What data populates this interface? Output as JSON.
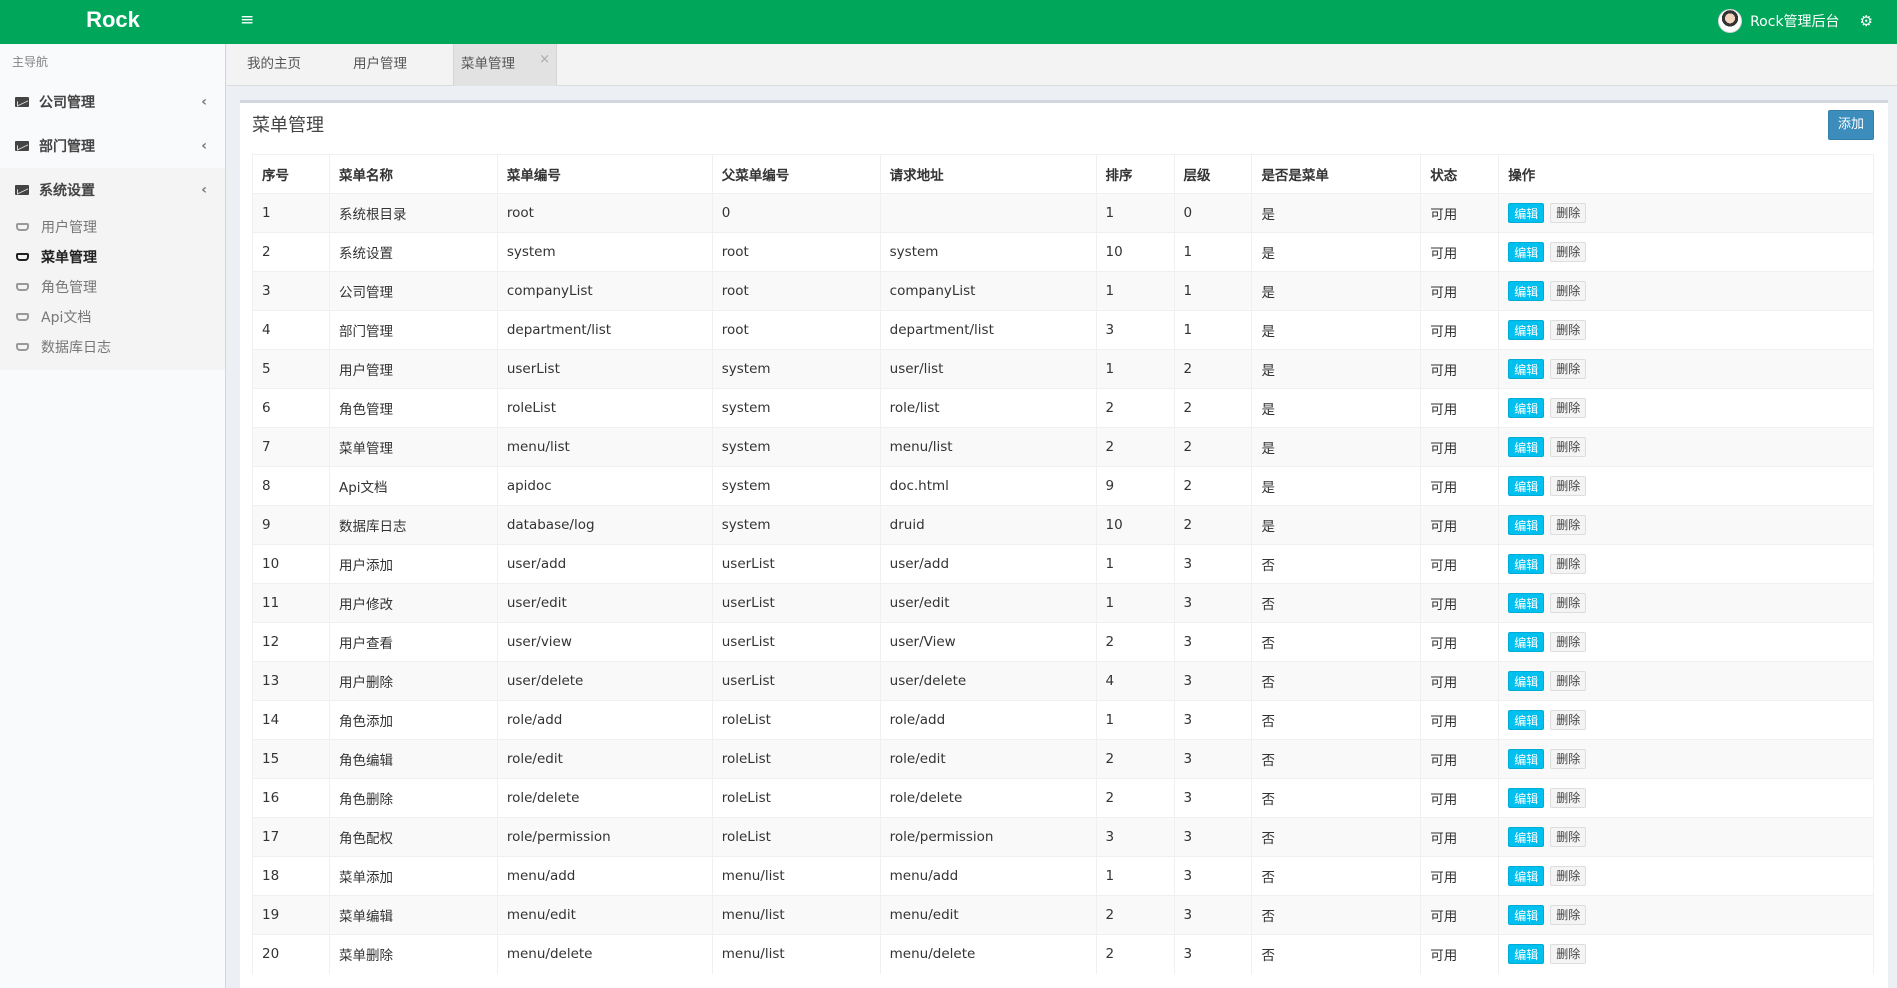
{
  "app": {
    "logo": "Rock",
    "user_name": "Rock管理后台",
    "menu_icon": "hamburger-icon",
    "settings_icon": "gear-icon",
    "theme_color": "#00a65a"
  },
  "sidebar": {
    "header": "主导航",
    "menus": [
      {
        "label": "公司管理",
        "icon": "envelope-icon"
      },
      {
        "label": "部门管理",
        "icon": "envelope-icon"
      },
      {
        "label": "系统设置",
        "icon": "envelope-icon"
      }
    ],
    "submenu": [
      {
        "label": "用户管理",
        "icon": "inbox-icon"
      },
      {
        "label": "菜单管理",
        "icon": "inbox-icon",
        "active": true
      },
      {
        "label": "角色管理",
        "icon": "inbox-icon"
      },
      {
        "label": "Api文档",
        "icon": "inbox-icon"
      },
      {
        "label": "数据库日志",
        "icon": "inbox-icon"
      }
    ]
  },
  "tabs": [
    {
      "label": "我的主页"
    },
    {
      "label": "用户管理"
    },
    {
      "label": "菜单管理",
      "active": true,
      "close": "×"
    }
  ],
  "box": {
    "title": "菜单管理",
    "add_label": "添加"
  },
  "table": {
    "columns": [
      "序号",
      "菜单名称",
      "菜单编号",
      "父菜单编号",
      "请求地址",
      "排序",
      "层级",
      "是否是菜单",
      "状态",
      "操作"
    ],
    "edit_label": "编辑",
    "delete_label": "删除",
    "rows": [
      [
        "1",
        "系统根目录",
        "root",
        "0",
        "",
        "1",
        "0",
        "是",
        "可用"
      ],
      [
        "2",
        "系统设置",
        "system",
        "root",
        "system",
        "10",
        "1",
        "是",
        "可用"
      ],
      [
        "3",
        "公司管理",
        "companyList",
        "root",
        "companyList",
        "1",
        "1",
        "是",
        "可用"
      ],
      [
        "4",
        "部门管理",
        "department/list",
        "root",
        "department/list",
        "3",
        "1",
        "是",
        "可用"
      ],
      [
        "5",
        "用户管理",
        "userList",
        "system",
        "user/list",
        "1",
        "2",
        "是",
        "可用"
      ],
      [
        "6",
        "角色管理",
        "roleList",
        "system",
        "role/list",
        "2",
        "2",
        "是",
        "可用"
      ],
      [
        "7",
        "菜单管理",
        "menu/list",
        "system",
        "menu/list",
        "2",
        "2",
        "是",
        "可用"
      ],
      [
        "8",
        "Api文档",
        "apidoc",
        "system",
        "doc.html",
        "9",
        "2",
        "是",
        "可用"
      ],
      [
        "9",
        "数据库日志",
        "database/log",
        "system",
        "druid",
        "10",
        "2",
        "是",
        "可用"
      ],
      [
        "10",
        "用户添加",
        "user/add",
        "userList",
        "user/add",
        "1",
        "3",
        "否",
        "可用"
      ],
      [
        "11",
        "用户修改",
        "user/edit",
        "userList",
        "user/edit",
        "1",
        "3",
        "否",
        "可用"
      ],
      [
        "12",
        "用户查看",
        "user/view",
        "userList",
        "user/View",
        "2",
        "3",
        "否",
        "可用"
      ],
      [
        "13",
        "用户删除",
        "user/delete",
        "userList",
        "user/delete",
        "4",
        "3",
        "否",
        "可用"
      ],
      [
        "14",
        "角色添加",
        "role/add",
        "roleList",
        "role/add",
        "1",
        "3",
        "否",
        "可用"
      ],
      [
        "15",
        "角色编辑",
        "role/edit",
        "roleList",
        "role/edit",
        "2",
        "3",
        "否",
        "可用"
      ],
      [
        "16",
        "角色删除",
        "role/delete",
        "roleList",
        "role/delete",
        "2",
        "3",
        "否",
        "可用"
      ],
      [
        "17",
        "角色配权",
        "role/permission",
        "roleList",
        "role/permission",
        "3",
        "3",
        "否",
        "可用"
      ],
      [
        "18",
        "菜单添加",
        "menu/add",
        "menu/list",
        "menu/add",
        "1",
        "3",
        "否",
        "可用"
      ],
      [
        "19",
        "菜单编辑",
        "menu/edit",
        "menu/list",
        "menu/edit",
        "2",
        "3",
        "否",
        "可用"
      ],
      [
        "20",
        "菜单删除",
        "menu/delete",
        "menu/list",
        "menu/delete",
        "2",
        "3",
        "否",
        "可用"
      ]
    ]
  }
}
